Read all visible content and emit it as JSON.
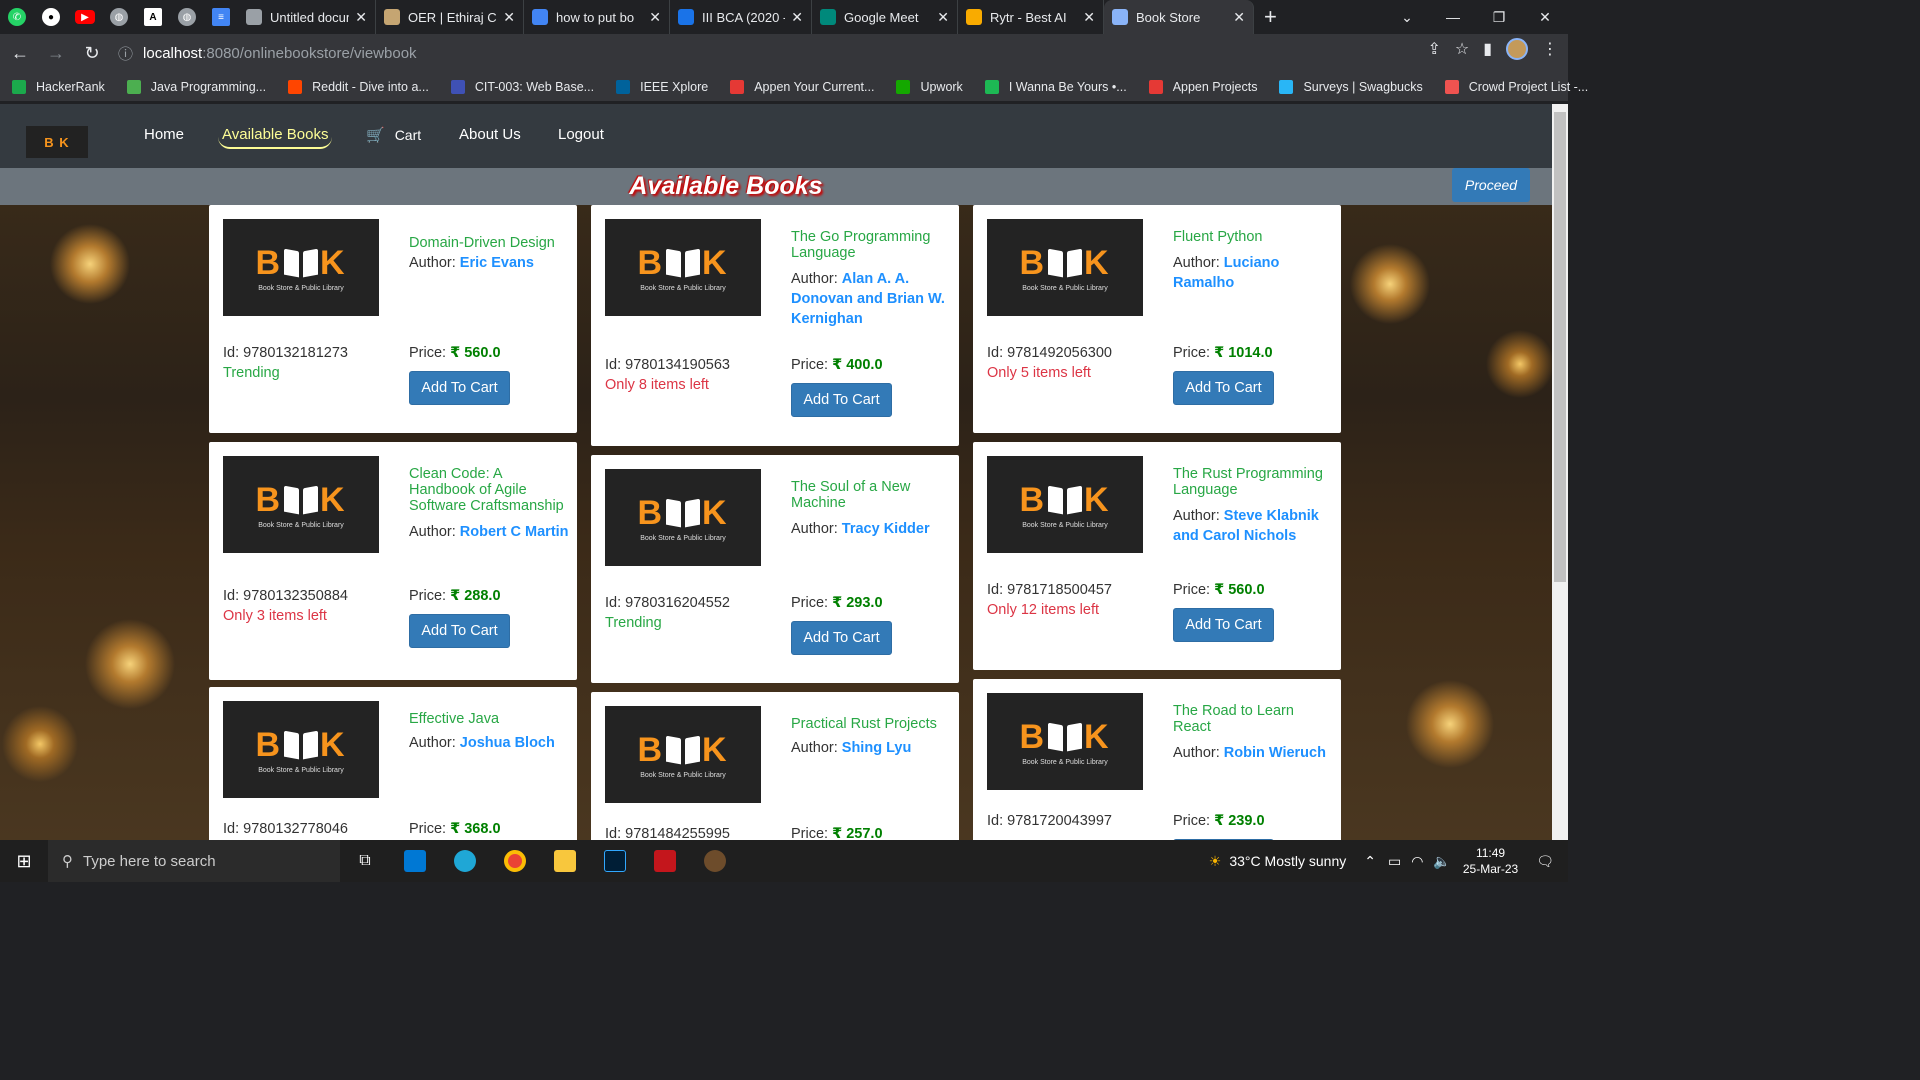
{
  "browser": {
    "tabs": [
      {
        "title": "Untitled docum",
        "color": "#9aa0a6"
      },
      {
        "title": "OER | Ethiraj C",
        "color": "#c5a572"
      },
      {
        "title": "how to put bo",
        "color": "#4285f4"
      },
      {
        "title": "III BCA (2020 -",
        "color": "#1a73e8"
      },
      {
        "title": "Google Meet",
        "color": "#00897b"
      },
      {
        "title": "Rytr - Best AI",
        "color": "#f9ab00"
      },
      {
        "title": "Book Store",
        "color": "#8ab4f8"
      }
    ],
    "url_host": "localhost",
    "url_path": ":8080/onlinebookstore/viewbook",
    "bookmarks": [
      {
        "label": "HackerRank",
        "color": "#1ba94c"
      },
      {
        "label": "Java Programming...",
        "color": "#4caf50"
      },
      {
        "label": "Reddit - Dive into a...",
        "color": "#ff4500"
      },
      {
        "label": "CIT-003: Web Base...",
        "color": "#3f51b5"
      },
      {
        "label": "IEEE Xplore",
        "color": "#00629b"
      },
      {
        "label": "Appen Your Current...",
        "color": "#e53935"
      },
      {
        "label": "Upwork",
        "color": "#14a800"
      },
      {
        "label": "I Wanna Be Yours •...",
        "color": "#1db954"
      },
      {
        "label": "Appen Projects",
        "color": "#e53935"
      },
      {
        "label": "Surveys | Swagbucks",
        "color": "#29b6f6"
      },
      {
        "label": "Crowd Project List -...",
        "color": "#ef5350"
      }
    ]
  },
  "site": {
    "logo": "B  K",
    "nav": {
      "home": "Home",
      "available": "Available Books",
      "cart": "Cart",
      "about": "About Us",
      "logout": "Logout"
    },
    "page_title": "Available Books",
    "proceed": "Proceed",
    "cover_brand": "BOOK",
    "cover_tag": "Book Store & Public Library",
    "author_prefix": "Author:",
    "id_prefix": "Id:",
    "price_prefix": "Price:",
    "add_label": "Add To Cart"
  },
  "books": [
    {
      "name": "Domain-Driven Design",
      "author": "Eric Evans",
      "id": "9780132181273",
      "stock": "Trending",
      "stock_type": "trend",
      "price": "₹ 560.0"
    },
    {
      "name": "The Go Programming Language",
      "author": "Alan A. A. Donovan and Brian W. Kernighan",
      "id": "9780134190563",
      "stock": "Only 8 items left",
      "stock_type": "low",
      "price": "₹ 400.0"
    },
    {
      "name": "Fluent Python",
      "author": "Luciano Ramalho",
      "id": "9781492056300",
      "stock": "Only 5 items left",
      "stock_type": "low",
      "price": "₹ 1014.0"
    },
    {
      "name": "Clean Code: A Handbook of Agile Software Craftsmanship",
      "author": "Robert C Martin",
      "id": "9780132350884",
      "stock": "Only 3 items left",
      "stock_type": "low",
      "price": "₹ 288.0"
    },
    {
      "name": "The Soul of a New Machine",
      "author": "Tracy Kidder",
      "id": "9780316204552",
      "stock": "Trending",
      "stock_type": "trend",
      "price": "₹ 293.0"
    },
    {
      "name": "The Rust Programming Language",
      "author": "Steve Klabnik and Carol Nichols",
      "id": "9781718500457",
      "stock": "Only 12 items left",
      "stock_type": "low",
      "price": "₹ 560.0"
    },
    {
      "name": "Effective Java",
      "author": "Joshua Bloch",
      "id": "9780132778046",
      "stock": "",
      "stock_type": "trend",
      "price": "₹ 368.0"
    },
    {
      "name": "Practical Rust Projects",
      "author": "Shing Lyu",
      "id": "9781484255995",
      "stock": "",
      "stock_type": "trend",
      "price": "₹ 257.0"
    },
    {
      "name": "The Road to Learn React",
      "author": "Robin Wieruch",
      "id": "9781720043997",
      "stock": "",
      "stock_type": "low",
      "price": "₹ 239.0"
    }
  ],
  "taskbar": {
    "search_placeholder": "Type here to search",
    "weather": "33°C  Mostly sunny",
    "time": "11:49",
    "date": "25-Mar-23"
  }
}
